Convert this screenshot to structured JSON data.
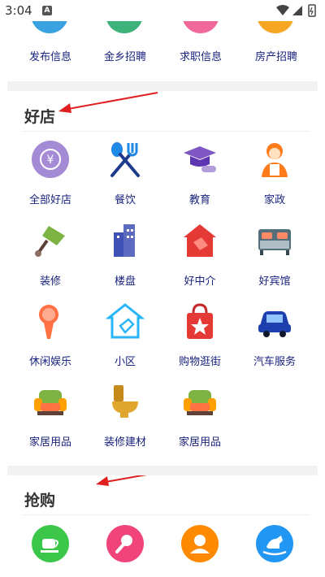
{
  "status_bar": {
    "time": "3:04",
    "notification_badge": "A"
  },
  "top_row": [
    {
      "label": "发布信息",
      "color": "#3aa2e0"
    },
    {
      "label": "金乡招聘",
      "color": "#3db37a"
    },
    {
      "label": "求职信息",
      "color": "#f0689a"
    },
    {
      "label": "房产招聘",
      "color": "#f5a623"
    }
  ],
  "haodian": {
    "title": "好店",
    "items": [
      {
        "label": "全部好店",
        "icon": "yen-icon"
      },
      {
        "label": "餐饮",
        "icon": "fork-spoon-icon"
      },
      {
        "label": "教育",
        "icon": "graduation-cap-icon"
      },
      {
        "label": "家政",
        "icon": "housekeeper-icon"
      },
      {
        "label": "装修",
        "icon": "paint-brush-icon"
      },
      {
        "label": "楼盘",
        "icon": "buildings-icon"
      },
      {
        "label": "好中介",
        "icon": "house-agent-icon"
      },
      {
        "label": "好宾馆",
        "icon": "bed-icon"
      },
      {
        "label": "休闲娱乐",
        "icon": "microphone-icon"
      },
      {
        "label": "小区",
        "icon": "house-tag-icon"
      },
      {
        "label": "购物逛街",
        "icon": "shopping-bag-icon"
      },
      {
        "label": "汽车服务",
        "icon": "car-icon"
      },
      {
        "label": "家居用品",
        "icon": "armchair-icon"
      },
      {
        "label": "装修建材",
        "icon": "toilet-icon"
      },
      {
        "label": "家居用品",
        "icon": "armchair-icon"
      }
    ]
  },
  "qianggou": {
    "title": "抢购",
    "items": [
      {
        "icon": "coffee-cup-icon",
        "color": "#3dc74a"
      },
      {
        "icon": "microphone-icon",
        "color": "#f0447a"
      },
      {
        "icon": "person-icon",
        "color": "#ff8a00"
      },
      {
        "icon": "rocking-horse-icon",
        "color": "#2196f3"
      }
    ]
  },
  "colors": {
    "label": "#1a237e",
    "divider": "#f2f2f2",
    "arrow": "#e02020"
  }
}
